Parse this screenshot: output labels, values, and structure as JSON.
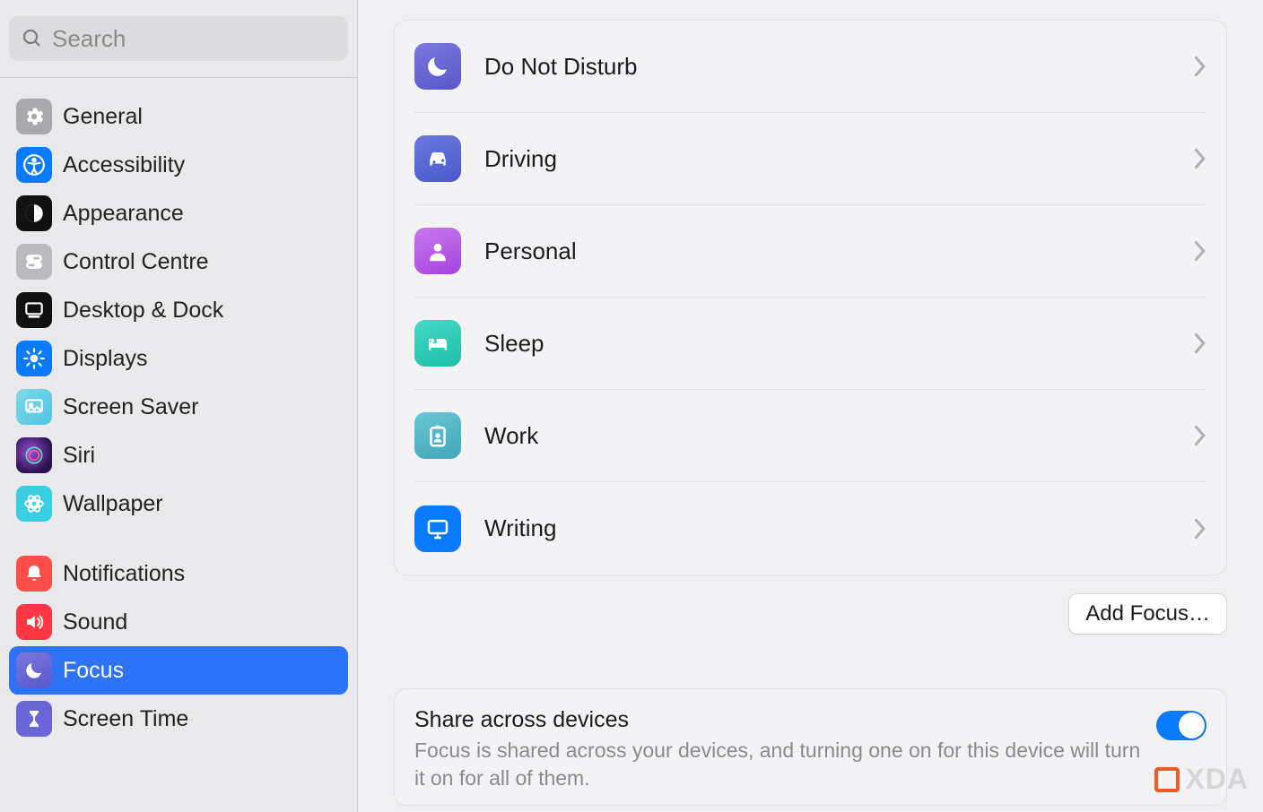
{
  "search": {
    "placeholder": "Search"
  },
  "sidebar": {
    "groups": [
      [
        {
          "label": "General",
          "icon": "gear",
          "bg": "#a9a9ad"
        },
        {
          "label": "Accessibility",
          "icon": "accessibility",
          "bg": "#0a7aff"
        },
        {
          "label": "Appearance",
          "icon": "appearance",
          "bg": "#111"
        },
        {
          "label": "Control Centre",
          "icon": "controlcentre",
          "bg": "#b9b9be"
        },
        {
          "label": "Desktop & Dock",
          "icon": "dock",
          "bg": "#111"
        },
        {
          "label": "Displays",
          "icon": "displays",
          "bg": "#0a7aff"
        },
        {
          "label": "Screen Saver",
          "icon": "screensaver",
          "bg": "#4ec6e0"
        },
        {
          "label": "Siri",
          "icon": "siri",
          "bg": "#1a1328"
        },
        {
          "label": "Wallpaper",
          "icon": "wallpaper",
          "bg": "#39cfe0"
        }
      ],
      [
        {
          "label": "Notifications",
          "icon": "bell",
          "bg": "#ff4d4a"
        },
        {
          "label": "Sound",
          "icon": "sound",
          "bg": "#ff3745"
        },
        {
          "label": "Focus",
          "icon": "moon",
          "bg": "#6a66d8",
          "selected": true
        },
        {
          "label": "Screen Time",
          "icon": "hourglass",
          "bg": "#6a66d8"
        }
      ]
    ]
  },
  "focus": {
    "modes": [
      {
        "label": "Do Not Disturb",
        "icon": "moon",
        "bg": "#6a66d8"
      },
      {
        "label": "Driving",
        "icon": "car",
        "bg": "#5a6bd8"
      },
      {
        "label": "Personal",
        "icon": "person",
        "bg": "#b658e8"
      },
      {
        "label": "Sleep",
        "icon": "bed",
        "bg": "#2fcdbd"
      },
      {
        "label": "Work",
        "icon": "badge",
        "bg": "#4fb7c7"
      },
      {
        "label": "Writing",
        "icon": "display",
        "bg": "#0a7aff"
      }
    ],
    "add_button": "Add Focus…",
    "share": {
      "title": "Share across devices",
      "desc": "Focus is shared across your devices, and turning one on for this device will turn it on for all of them.",
      "on": true
    }
  },
  "watermark": "XDA"
}
